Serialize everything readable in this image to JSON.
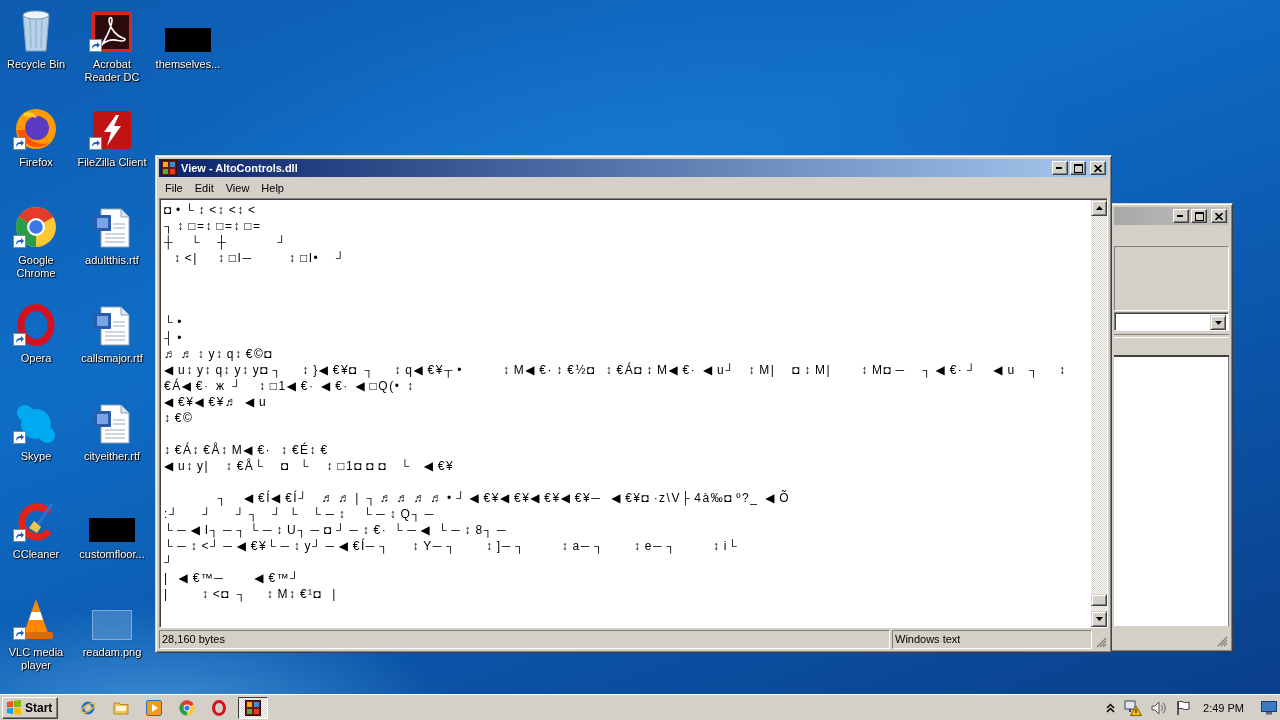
{
  "desktop_icons": [
    {
      "label": "Recycle Bin",
      "kind": "recycle-bin",
      "shortcut": false
    },
    {
      "label": "Firefox",
      "kind": "firefox",
      "shortcut": true
    },
    {
      "label": "Google Chrome",
      "kind": "chrome",
      "shortcut": true
    },
    {
      "label": "Opera",
      "kind": "opera",
      "shortcut": true
    },
    {
      "label": "Skype",
      "kind": "skype",
      "shortcut": true
    },
    {
      "label": "CCleaner",
      "kind": "ccleaner",
      "shortcut": true
    },
    {
      "label": "VLC media player",
      "kind": "vlc",
      "shortcut": true
    },
    {
      "label": "Acrobat Reader DC",
      "kind": "acrobat",
      "shortcut": true
    },
    {
      "label": "FileZilla Client",
      "kind": "filezilla",
      "shortcut": true
    },
    {
      "label": "adultthis.rtf",
      "kind": "word",
      "shortcut": false
    },
    {
      "label": "callsmajor.rtf",
      "kind": "word",
      "shortcut": false
    },
    {
      "label": "cityeither.rtf",
      "kind": "word",
      "shortcut": false
    },
    {
      "label": "customfloor...",
      "kind": "blank",
      "shortcut": false
    },
    {
      "label": "readam.png",
      "kind": "image",
      "shortcut": false
    },
    {
      "label": "themselves...",
      "kind": "blank",
      "shortcut": false
    }
  ],
  "background_window": {
    "active": false
  },
  "viewer_window": {
    "title": "View - AltoControls.dll",
    "active": true,
    "menu": [
      "File",
      "Edit",
      "View",
      "Help"
    ],
    "content": "◘ • └ ↕ <↕ <↕ <\n┐ ↕ □=↕ □=↕ □=\n┼     └     ┼               ┘\n   ↕ <|      ↕ □I─           ↕ □I•     ┘\n\n\n\n└ •\n┤ •\n♬ ♬ ↕ y↕ q↕ €©◘\n◀ u↕ y↕ q↕ y↕ y◘ ┐      ↕ }◀ €¥◘  ┐      ↕ q◀ €¥┬ •            ↕ M◀ €· ↕ €½◘   ↕ €Á◘ ↕ M◀ €·  ◀ u┘    ↕ M|     ◘ ↕ M|         ↕ M◘ ─     ┐ ◀ €· ┘     ◀ u    ┐      ↕\n€Á◀ €·  ж  ┘     ↕ □1◀ €·  ◀ €·  ◀ □Q(•  ↕\n◀ €¥◀ €¥♬  ◀ u\n↕ €©\n\n↕ €Á↕ €Å↕ M◀ €·   ↕ €É↕ €\n◀ u↕ y|     ↕ €Å└     ◘   └     ↕ □1◘ ◘ ◘    └    ◀ €¥\n\n                ┐     ◀ €Í◀ €Í┘    ♬ ♬ |  ┐ ♬ ♬ ♬ ♬ • ┘ ◀ €¥◀ €¥◀ €¥◀ €¥─   ◀ €¥◘ ·z\\V├ 4à‰◘ º?_  ◀ Õ\n:┘       ┘       ┘ ┐    ┘  └    └ ─ ↕     └ ─ ↕ Q┐ ─\n└ ─ ◀ I┐ ─ ┐ └ ─ ↕ U┐ ─ ◘ ┘ ─ ↕ €·  └ ─ ◀  └ ─ ↕ 8┐ ─\n└ ─ ↕ <┘ ─ ◀ €¥└ ─ ↕ y┘ ─ ◀ €Í─ ┐       ↕ Y─ ┐         ↕ ]─ ┐           ↕ a─ ┐         ↕ e─ ┐           ↕ i└\n┘\n|   ◀ €™─         ◀ €™┘\n|          ↕ <◘  ┐      ↕ M↕ €¹◘   |",
    "status": [
      "28,160 bytes",
      "Windows text"
    ]
  },
  "taskbar": {
    "start_label": "Start",
    "quick_launch": [
      {
        "kind": "browser"
      },
      {
        "kind": "folder"
      },
      {
        "kind": "media"
      },
      {
        "kind": "chrome"
      },
      {
        "kind": "opera"
      }
    ],
    "tasks": [
      {
        "kind": "viewer",
        "selected": true
      }
    ],
    "clock": "2:49 PM"
  }
}
